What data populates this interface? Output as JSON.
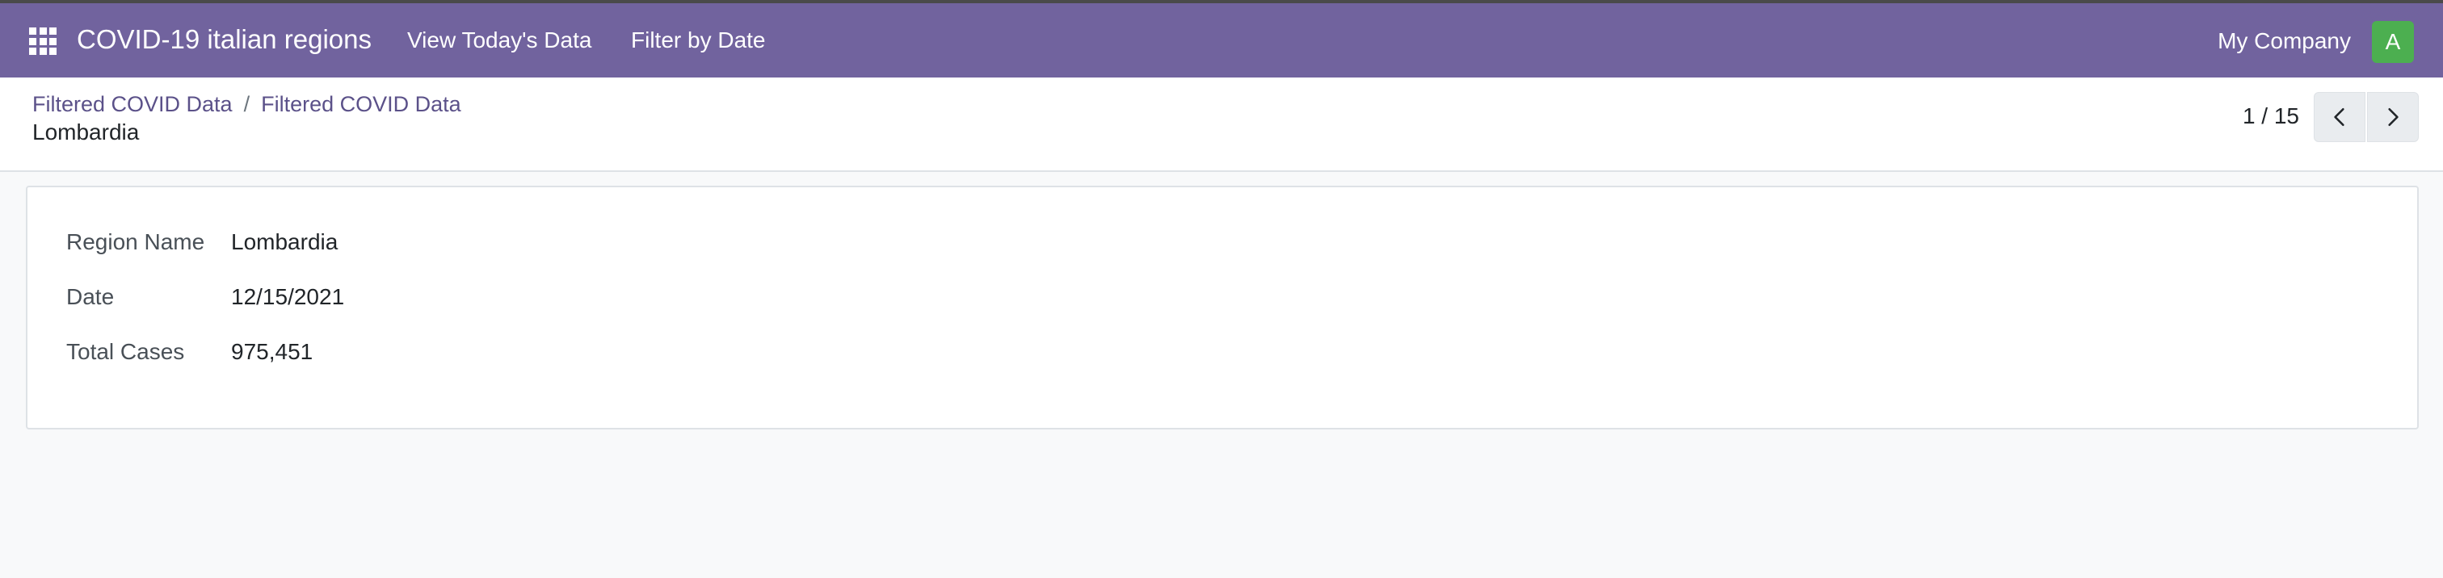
{
  "navbar": {
    "app_title": "COVID-19 italian regions",
    "menu": [
      "View Today's Data",
      "Filter by Date"
    ],
    "company": "My Company",
    "avatar_initial": "A"
  },
  "breadcrumb": {
    "items": [
      "Filtered COVID Data",
      "Filtered COVID Data"
    ],
    "separator": "/",
    "current": "Lombardia"
  },
  "pager": {
    "value": "1 / 15"
  },
  "form": {
    "fields": [
      {
        "label": "Region Name",
        "value": "Lombardia"
      },
      {
        "label": "Date",
        "value": "12/15/2021"
      },
      {
        "label": "Total Cases",
        "value": "975,451"
      }
    ]
  },
  "colors": {
    "navbar": "#71639e",
    "link": "#5b5189",
    "avatar": "#4caf50",
    "background": "#f8f9fa"
  },
  "icons": {
    "apps": "apps-grid-icon",
    "prev": "chevron-left-icon",
    "next": "chevron-right-icon"
  }
}
